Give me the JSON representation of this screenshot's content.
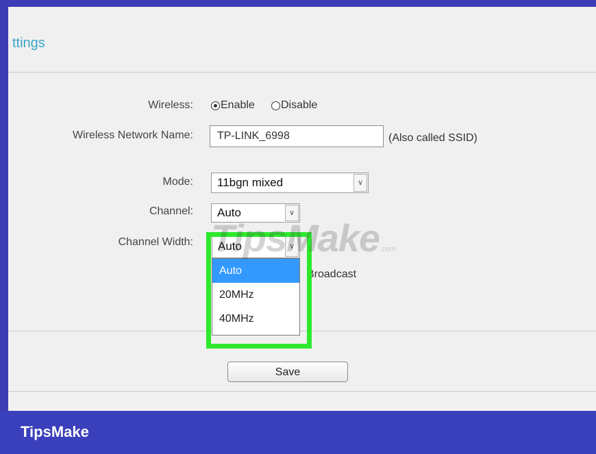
{
  "section_title": "ttings",
  "form": {
    "wireless_label": "Wireless:",
    "enable_label": "Enable",
    "disable_label": "Disable",
    "selected_option": "Enable",
    "network_name_label": "Wireless Network Name:",
    "network_name_value": "TP-LINK_6998",
    "ssid_note": "(Also called SSID)",
    "mode_label": "Mode:",
    "mode_value": "11bgn mixed",
    "channel_label": "Channel:",
    "channel_value": "Auto",
    "channel_width_label": "Channel Width:",
    "channel_width_value": "Auto",
    "channel_width_options": [
      "Auto",
      "20MHz",
      "40MHz"
    ],
    "broadcast_label": "Broadcast"
  },
  "save_label": "Save",
  "watermark": {
    "main": "TipsMake",
    "suffix": ".com"
  },
  "footer_brand": "TipsMake",
  "colors": {
    "frame": "#3c3cb4",
    "title": "#39a5c6",
    "highlight": "#2ee82e",
    "selected_option": "#3399ff"
  }
}
